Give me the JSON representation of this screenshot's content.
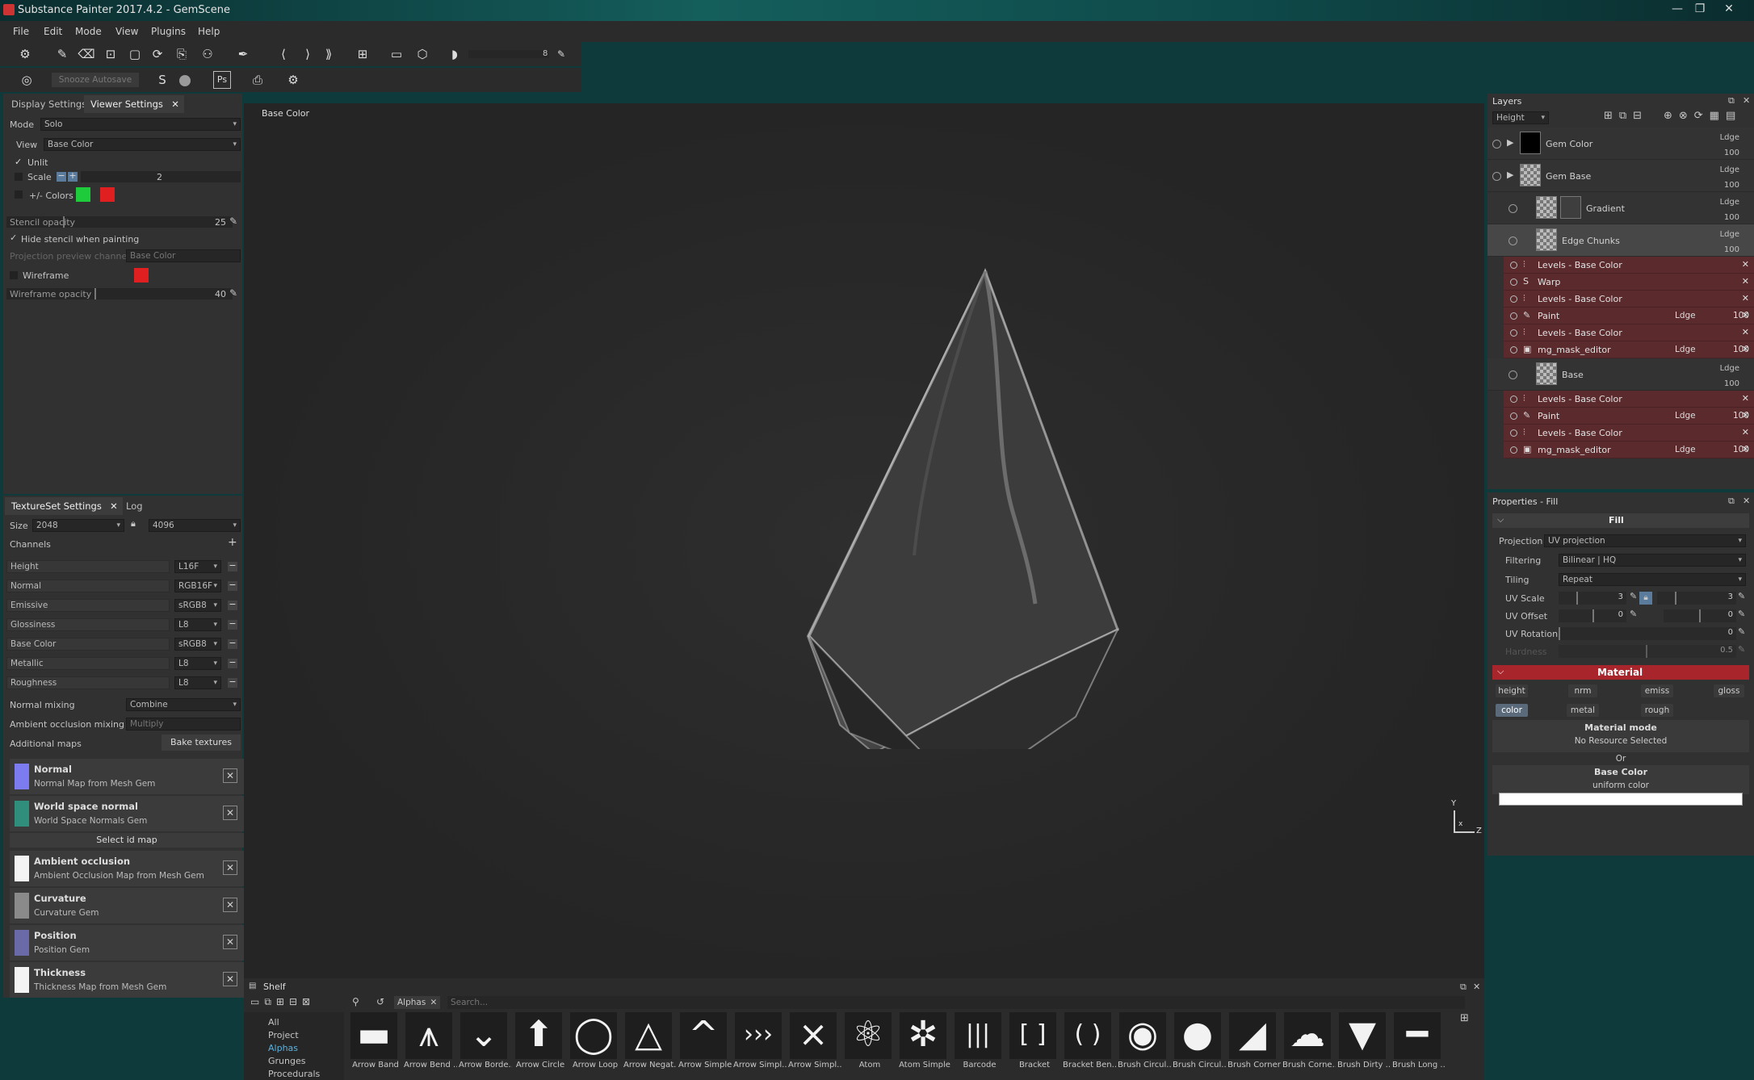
{
  "window": {
    "title": "Substance Painter 2017.4.2 - GemScene",
    "controls": [
      "—",
      "❐",
      "✕"
    ]
  },
  "menu": [
    "File",
    "Edit",
    "Mode",
    "View",
    "Plugins",
    "Help"
  ],
  "toolbar": {
    "snooze_label": "Snooze Autosave",
    "ps_label": "Ps",
    "brush_size": "8"
  },
  "left_top": {
    "tabs": [
      "Display Settings",
      "Viewer Settings"
    ],
    "mode_label": "Mode",
    "mode_value": "Solo",
    "view_label": "View",
    "view_value": "Base Color",
    "unlit_label": "Unlit",
    "scale_label": "Scale",
    "scale_value": "2",
    "colors_label": "+/- Colors",
    "colors": {
      "plus": "#1ecb3a",
      "minus": "#e02020",
      "wire": "#e02020"
    },
    "stencil_label": "Stencil opacity",
    "stencil_value": "25",
    "hide_stencil_label": "Hide stencil when painting",
    "proj_channel_label": "Projection preview channel",
    "proj_channel_value": "Base Color",
    "wireframe_label": "Wireframe",
    "wire_opacity_label": "Wireframe opacity",
    "wire_opacity_value": "40"
  },
  "textureset": {
    "tabs": [
      "TextureSet Settings",
      "Log"
    ],
    "size_label": "Size",
    "size_value": "2048",
    "size_value2": "4096",
    "channels_label": "Channels",
    "channels": [
      {
        "name": "Height",
        "format": "L16F"
      },
      {
        "name": "Normal",
        "format": "RGB16F"
      },
      {
        "name": "Emissive",
        "format": "sRGB8"
      },
      {
        "name": "Glossiness",
        "format": "L8"
      },
      {
        "name": "Base Color",
        "format": "sRGB8"
      },
      {
        "name": "Metallic",
        "format": "L8"
      },
      {
        "name": "Roughness",
        "format": "L8"
      }
    ],
    "normal_mixing_label": "Normal mixing",
    "normal_mixing_value": "Combine",
    "ao_mixing_label": "Ambient occlusion mixing",
    "ao_mixing_value": "Multiply",
    "additional_label": "Additional maps",
    "bake_label": "Bake textures",
    "select_id_label": "Select id map",
    "maps": [
      {
        "name": "Normal",
        "desc": "Normal Map from Mesh Gem",
        "color": "#7c7cf0"
      },
      {
        "name": "World space normal",
        "desc": "World Space Normals Gem",
        "color": "#2f8f7c"
      },
      {
        "name": "Ambient occlusion",
        "desc": "Ambient Occlusion Map from Mesh Gem",
        "color": "#f4f4f4"
      },
      {
        "name": "Curvature",
        "desc": "Curvature Gem",
        "color": "#8a8a8a"
      },
      {
        "name": "Position",
        "desc": "Position Gem",
        "color": "#6a6aa8"
      },
      {
        "name": "Thickness",
        "desc": "Thickness Map from Mesh Gem",
        "color": "#f4f4f4"
      }
    ]
  },
  "viewport": {
    "channel_label": "Base Color",
    "axis_y": "Y",
    "axis_z": "Z",
    "axis_x": "x"
  },
  "layers": {
    "title": "Layers",
    "channel": "Height",
    "rows": [
      {
        "name": "Gem Color",
        "blend": "Ldge",
        "opacity": "100"
      },
      {
        "name": "Gem Base",
        "blend": "Ldge",
        "opacity": "100"
      },
      {
        "name": "Gradient",
        "blend": "Ldge",
        "opacity": "100"
      },
      {
        "name": "Edge Chunks",
        "blend": "Ldge",
        "opacity": "100"
      },
      {
        "name": "Base",
        "blend": "Ldge",
        "opacity": "100"
      }
    ],
    "effects_edge": [
      {
        "icon": "levels-icon",
        "glyph": "⫶",
        "name": "Levels - Base Color",
        "blend": "",
        "op": ""
      },
      {
        "icon": "warp-icon",
        "glyph": "S",
        "name": "Warp",
        "blend": "",
        "op": ""
      },
      {
        "icon": "levels-icon",
        "glyph": "⫶",
        "name": "Levels - Base Color",
        "blend": "",
        "op": ""
      },
      {
        "icon": "paint-icon",
        "glyph": "✎",
        "name": "Paint",
        "blend": "Ldge",
        "op": "100"
      },
      {
        "icon": "levels-icon",
        "glyph": "⫶",
        "name": "Levels - Base Color",
        "blend": "",
        "op": ""
      },
      {
        "icon": "mask-icon",
        "glyph": "▣",
        "name": "mg_mask_editor",
        "blend": "Ldge",
        "op": "100"
      }
    ],
    "effects_base": [
      {
        "icon": "levels-icon",
        "glyph": "⫶",
        "name": "Levels - Base Color",
        "blend": "",
        "op": ""
      },
      {
        "icon": "paint-icon",
        "glyph": "✎",
        "name": "Paint",
        "blend": "Ldge",
        "op": "100"
      },
      {
        "icon": "levels-icon",
        "glyph": "⫶",
        "name": "Levels - Base Color",
        "blend": "",
        "op": ""
      },
      {
        "icon": "mask-icon",
        "glyph": "▣",
        "name": "mg_mask_editor",
        "blend": "Ldge",
        "op": "100"
      }
    ]
  },
  "properties": {
    "title": "Properties - Fill",
    "fill_header": "Fill",
    "projection_label": "Projection",
    "projection_value": "UV projection",
    "filtering_label": "Filtering",
    "filtering_value": "Bilinear | HQ",
    "tiling_label": "Tiling",
    "tiling_value": "Repeat",
    "uvscale_label": "UV Scale",
    "uvscale_a": "3",
    "uvscale_b": "3",
    "uvoffset_label": "UV Offset",
    "uvoffset_a": "0",
    "uvoffset_b": "0",
    "uvrot_label": "UV Rotation",
    "uvrot_value": "0",
    "hardness_label": "Hardness",
    "hardness_value": "0.5",
    "material_header": "Material",
    "mat_buttons": [
      "height",
      "nrm",
      "emiss",
      "gloss",
      "color",
      "metal",
      "rough"
    ],
    "material_mode_label": "Material mode",
    "no_resource": "No Resource Selected",
    "or_label": "Or",
    "base_color_label": "Base Color",
    "uniform_label": "uniform color",
    "base_color_swatch": "#ffffff"
  },
  "shelf": {
    "title": "Shelf",
    "filter_tag": "Alphas",
    "search_placeholder": "Search...",
    "categories": [
      "All",
      "Project",
      "Alphas",
      "Grunges",
      "Procedurals"
    ],
    "items": [
      {
        "name": "Arrow Band",
        "icon": "arrow-band-icon",
        "glyph": "▬"
      },
      {
        "name": "Arrow Bend ...",
        "icon": "arrow-bend-icon",
        "glyph": "⩚"
      },
      {
        "name": "Arrow Borde...",
        "icon": "arrow-border-icon",
        "glyph": "⌄"
      },
      {
        "name": "Arrow Circle",
        "icon": "arrow-circle-icon",
        "glyph": "⬆"
      },
      {
        "name": "Arrow Loop",
        "icon": "arrow-loop-icon",
        "glyph": "◯"
      },
      {
        "name": "Arrow Negat...",
        "icon": "arrow-negative-icon",
        "glyph": "△"
      },
      {
        "name": "Arrow Simple",
        "icon": "arrow-simple-icon",
        "glyph": "^"
      },
      {
        "name": "Arrow Simpl...",
        "icon": "arrow-simple2-icon",
        "glyph": "›››"
      },
      {
        "name": "Arrow Simpl...",
        "icon": "arrow-simple3-icon",
        "glyph": "⨯"
      },
      {
        "name": "Atom",
        "icon": "atom-icon",
        "glyph": "⚛"
      },
      {
        "name": "Atom Simple",
        "icon": "atom-simple-icon",
        "glyph": "✲"
      },
      {
        "name": "Barcode",
        "icon": "barcode-icon",
        "glyph": "|||"
      },
      {
        "name": "Bracket",
        "icon": "bracket-icon",
        "glyph": "[ ]"
      },
      {
        "name": "Bracket Ben...",
        "icon": "bracket-bent-icon",
        "glyph": "( )"
      },
      {
        "name": "Brush Circul...",
        "icon": "brush-circular-icon",
        "glyph": "◉"
      },
      {
        "name": "Brush Circul...",
        "icon": "brush-circular2-icon",
        "glyph": "●"
      },
      {
        "name": "Brush Corner",
        "icon": "brush-corner-icon",
        "glyph": "◢"
      },
      {
        "name": "Brush Corne...",
        "icon": "brush-corner2-icon",
        "glyph": "☁"
      },
      {
        "name": "Brush Dirty ...",
        "icon": "brush-dirty-icon",
        "glyph": "▼"
      },
      {
        "name": "Brush Long ...",
        "icon": "brush-long-icon",
        "glyph": "━"
      }
    ]
  }
}
